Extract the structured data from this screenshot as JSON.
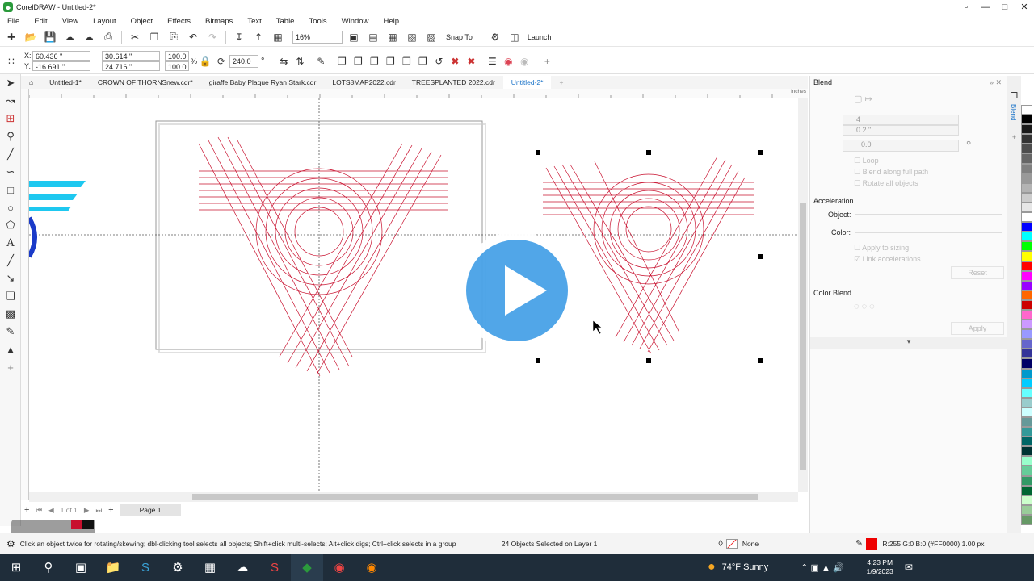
{
  "app": {
    "title": "CorelDRAW - Untitled-2*",
    "logo": "corel-logo-icon",
    "window_controls": [
      "▫",
      "—",
      "□",
      "✕"
    ]
  },
  "menu": [
    "File",
    "Edit",
    "View",
    "Layout",
    "Object",
    "Effects",
    "Bitmaps",
    "Text",
    "Table",
    "Tools",
    "Window",
    "Help"
  ],
  "toolbar": {
    "zoom": "16%",
    "snap_to": "Snap To",
    "launch": "Launch"
  },
  "props": {
    "x": "60.436 \"",
    "y": "-16.691 \"",
    "w": "30.614 \"",
    "h": "24.716 \"",
    "sx": "100.0",
    "sy": "100.0",
    "pct": "%",
    "angle": "240.0",
    "angle_unit": "°"
  },
  "tabs": [
    {
      "label": "Untitled-1*",
      "active": false
    },
    {
      "label": "CROWN OF THORNSnew.cdr*",
      "active": false
    },
    {
      "label": "giraffe Baby Plaque Ryan Stark.cdr",
      "active": false
    },
    {
      "label": "LOTS8MAP2022.cdr",
      "active": false
    },
    {
      "label": "TREESPLANTED 2022.cdr",
      "active": false
    },
    {
      "label": "Untitled-2*",
      "active": true
    }
  ],
  "ruler_unit": "inches",
  "pagebar": {
    "page_of": "1 of 1",
    "page_tab": "Page 1"
  },
  "docker": {
    "title": "Blend",
    "steps": "4",
    "spacing": "0.2 \"",
    "rotation": "0.0",
    "loop": "Loop",
    "blend_along_path": "Blend along full path",
    "rotate_all": "Rotate all objects",
    "acceleration": "Acceleration",
    "object": "Object:",
    "color": "Color:",
    "apply_to_sizing": "Apply to sizing",
    "link_accel": "Link accelerations",
    "reset": "Reset",
    "color_blend": "Color Blend",
    "apply": "Apply",
    "side_tab": "Blend"
  },
  "status": {
    "hint": "Click an object twice for rotating/skewing; dbl-clicking tool selects all objects; Shift+click multi-selects; Alt+click digs; Ctrl+click selects in a group",
    "selection": "24 Objects Selected on Layer 1",
    "fill": "None",
    "outline": "R:255 G:0 B:0 (#FF0000)  1.00 px"
  },
  "taskbar": {
    "weather": "74°F  Sunny",
    "time": "4:23 PM",
    "date": "1/9/2023"
  },
  "palette": [
    "#ffffff",
    "#000000",
    "#1a1a1a",
    "#333333",
    "#4d4d4d",
    "#666666",
    "#808080",
    "#999999",
    "#b3b3b3",
    "#cccccc",
    "#e6e6e6",
    "#ffffff",
    "#0000ff",
    "#00ffff",
    "#00ff00",
    "#ffff00",
    "#ff0000",
    "#ff00ff",
    "#9900ff",
    "#ff6600",
    "#cc0000",
    "#ff66cc",
    "#cc99ff",
    "#9999ff",
    "#6666cc",
    "#333399",
    "#000066",
    "#0099cc",
    "#00ccff",
    "#66ffff",
    "#99cccc",
    "#ccffff",
    "#669999",
    "#339999",
    "#006666",
    "#003333",
    "#99ffcc",
    "#66cc99",
    "#339966",
    "#006633",
    "#ccffcc",
    "#99cc99",
    "#669966"
  ],
  "colors": {
    "accent": "#1a73c8",
    "guide": "#cc0033",
    "play": "#4aa3e8"
  }
}
